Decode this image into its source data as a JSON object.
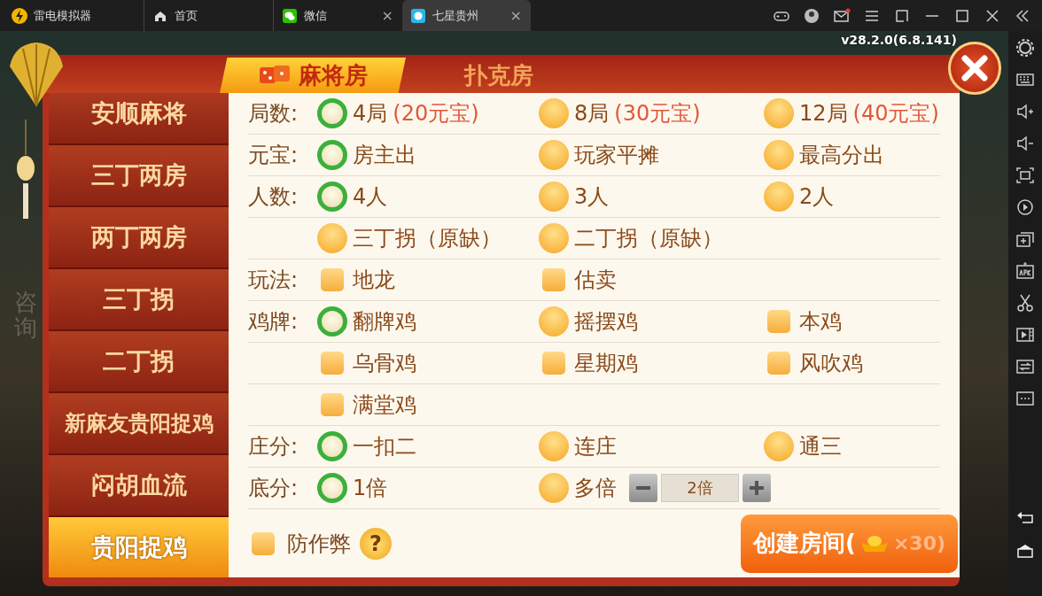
{
  "titlebar": {
    "app_name": "雷电模拟器",
    "tabs": [
      {
        "label": "首页",
        "selected": false
      },
      {
        "label": "微信",
        "selected": false,
        "close": "×"
      },
      {
        "label": "七星贵州",
        "selected": true,
        "close": "×"
      }
    ]
  },
  "game": {
    "version": "v28.2.0(6.8.141)",
    "side_text": "咨询",
    "room_tabs": [
      {
        "label": "麻将房",
        "selected": true
      },
      {
        "label": "扑克房",
        "selected": false
      }
    ],
    "modes": [
      {
        "label": "安顺麻将",
        "selected": false
      },
      {
        "label": "三丁两房",
        "selected": false
      },
      {
        "label": "两丁两房",
        "selected": false
      },
      {
        "label": "三丁拐",
        "selected": false
      },
      {
        "label": "二丁拐",
        "selected": false
      },
      {
        "label": "新麻友贵阳捉鸡",
        "selected": false
      },
      {
        "label": "闷胡血流",
        "selected": false
      },
      {
        "label": "贵阳捉鸡",
        "selected": true
      }
    ],
    "rows": [
      {
        "label": "局数:",
        "options": [
          {
            "kind": "radio",
            "text": "4局",
            "note": "(20元宝)",
            "selected": true
          },
          {
            "kind": "radio",
            "text": "8局",
            "note": "(30元宝)",
            "selected": false
          },
          {
            "kind": "radio",
            "text": "12局",
            "note": "(40元宝)",
            "selected": false
          }
        ]
      },
      {
        "label": "元宝:",
        "options": [
          {
            "kind": "radio",
            "text": "房主出",
            "selected": true
          },
          {
            "kind": "radio",
            "text": "玩家平摊",
            "selected": false
          },
          {
            "kind": "radio",
            "text": "最高分出",
            "selected": false
          }
        ]
      },
      {
        "label": "人数:",
        "options": [
          {
            "kind": "radio",
            "text": "4人",
            "selected": true
          },
          {
            "kind": "radio",
            "text": "3人",
            "selected": false
          },
          {
            "kind": "radio",
            "text": "2人",
            "selected": false
          }
        ]
      },
      {
        "options": [
          {
            "kind": "radio",
            "text": "三丁拐（原缺）",
            "selected": false
          },
          {
            "kind": "radio",
            "text": "二丁拐（原缺）",
            "selected": false
          }
        ]
      },
      {
        "label": "玩法:",
        "options": [
          {
            "kind": "checkbox",
            "text": "地龙",
            "checked": false
          },
          {
            "kind": "checkbox",
            "text": "估卖",
            "checked": false
          }
        ]
      },
      {
        "label": "鸡牌:",
        "options": [
          {
            "kind": "radio",
            "text": "翻牌鸡",
            "selected": true
          },
          {
            "kind": "radio",
            "text": "摇摆鸡",
            "selected": false
          },
          {
            "kind": "checkbox",
            "text": "本鸡",
            "checked": false
          }
        ]
      },
      {
        "options": [
          {
            "kind": "checkbox",
            "text": "乌骨鸡",
            "checked": false
          },
          {
            "kind": "checkbox",
            "text": "星期鸡",
            "checked": false
          },
          {
            "kind": "checkbox",
            "text": "风吹鸡",
            "checked": false
          }
        ]
      },
      {
        "options": [
          {
            "kind": "checkbox",
            "text": "满堂鸡",
            "checked": false
          }
        ]
      },
      {
        "label": "庄分:",
        "options": [
          {
            "kind": "radio",
            "text": "一扣二",
            "selected": true
          },
          {
            "kind": "radio",
            "text": "连庄",
            "selected": false
          },
          {
            "kind": "radio",
            "text": "通三",
            "selected": false
          }
        ]
      },
      {
        "label": "底分:",
        "options": [
          {
            "kind": "radio",
            "text": "1倍",
            "selected": true
          },
          {
            "kind": "radio",
            "text": "多倍",
            "selected": false,
            "stepper_value": "2倍"
          }
        ]
      }
    ],
    "anti_cheat": {
      "text": "防作弊",
      "checked": false,
      "help": "?"
    },
    "create_button": {
      "label": "创建房间(",
      "cost": "×30)"
    }
  }
}
